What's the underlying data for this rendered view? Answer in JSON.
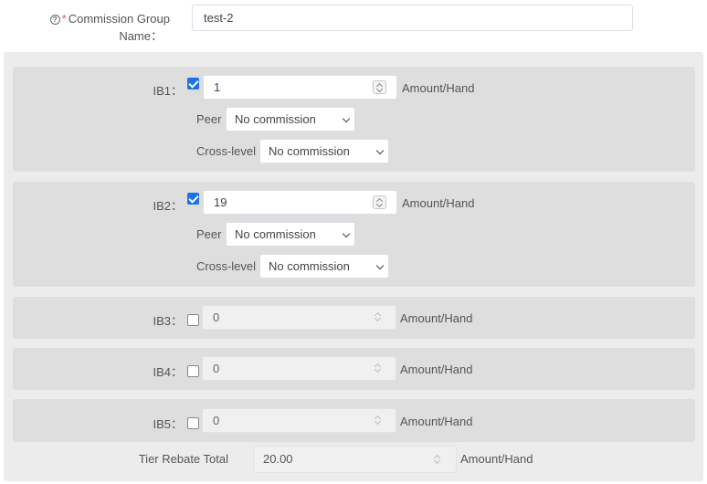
{
  "group": {
    "label_line1": "Commission Group",
    "label_line2": "Name：",
    "help_icon": "question-circle-icon",
    "required_mark": "*",
    "value": "test-2"
  },
  "unit": "Amount/Hand",
  "ib1": {
    "label": "IB1：",
    "checked": true,
    "value": "1",
    "peer_label": "Peer",
    "peer_value": "No commission",
    "cross_label": "Cross-level",
    "cross_value": "No commission"
  },
  "ib2": {
    "label": "IB2：",
    "checked": true,
    "value": "19",
    "peer_label": "Peer",
    "peer_value": "No commission",
    "cross_label": "Cross-level",
    "cross_value": "No commission"
  },
  "ib3": {
    "label": "IB3：",
    "checked": false,
    "value": "0"
  },
  "ib4": {
    "label": "IB4：",
    "checked": false,
    "value": "0"
  },
  "ib5": {
    "label": "IB5：",
    "checked": false,
    "value": "0"
  },
  "total": {
    "label": "Tier Rebate Total",
    "value": "20.00"
  },
  "colors": {
    "checkbox_on": "#1a73e8",
    "required_star": "#e55555",
    "panel_bg": "#ececec",
    "box_bg": "#dedede"
  }
}
